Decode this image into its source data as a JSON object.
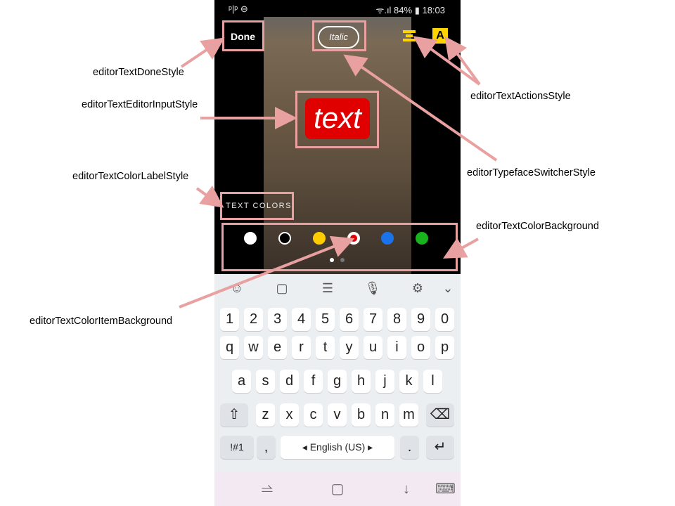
{
  "status_bar": {
    "left": "ᵖ|ᵖ ⊖",
    "right": "ᯤ.ıl 84% ▮ 18:03"
  },
  "editor": {
    "done_label": "Done",
    "typeface_label": "Italic",
    "text_value": "text",
    "text_background_icon": "A",
    "color_label": "TEXT COLORS",
    "colors": [
      "#ffffff",
      "#000000",
      "#ffcc00",
      "#ffffff",
      "#1a73e8",
      "#19b31e"
    ],
    "selected_color": "#e00000",
    "pager": {
      "active": 1,
      "total": 2
    }
  },
  "keyboard": {
    "toolbar_icons": [
      "emoji-icon",
      "sticker-icon",
      "clipboard-icon",
      "microphone-icon",
      "settings-icon",
      "collapse-icon"
    ],
    "row_numbers": [
      "1",
      "2",
      "3",
      "4",
      "5",
      "6",
      "7",
      "8",
      "9",
      "0"
    ],
    "row1": [
      "q",
      "w",
      "e",
      "r",
      "t",
      "y",
      "u",
      "i",
      "o",
      "p"
    ],
    "row2": [
      "a",
      "s",
      "d",
      "f",
      "g",
      "h",
      "j",
      "k",
      "l"
    ],
    "row3": [
      "z",
      "x",
      "c",
      "v",
      "b",
      "n",
      "m"
    ],
    "symbols_label": "!#1",
    "comma_label": ",",
    "space_label": "◂ English (US) ▸",
    "period_label": "."
  },
  "annotations": {
    "done_style": "editorTextDoneStyle",
    "input_style": "editorTextEditorInputStyle",
    "color_label_style": "editorTextColorLabelStyle",
    "color_item_background": "editorTextColorItemBackground",
    "actions_style": "editorTextActionsStyle",
    "typeface_switcher_style": "editorTypefaceSwitcherStyle",
    "color_background": "editorTextColorBackground"
  }
}
